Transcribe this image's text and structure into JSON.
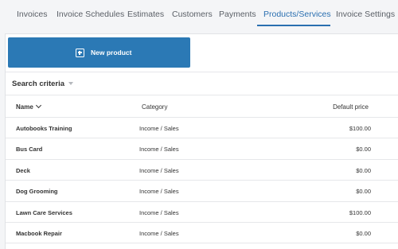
{
  "tabs": [
    {
      "label": "Invoices",
      "active": false
    },
    {
      "label": "Invoice Schedules",
      "active": false
    },
    {
      "label": "Estimates",
      "active": false
    },
    {
      "label": "Customers",
      "active": false
    },
    {
      "label": "Payments",
      "active": false
    },
    {
      "label": "Products/Services",
      "active": true
    },
    {
      "label": "Invoice Settings",
      "active": false
    }
  ],
  "actions": {
    "new_product_label": "New product"
  },
  "search": {
    "label": "Search criteria"
  },
  "table": {
    "columns": {
      "name": "Name",
      "category": "Category",
      "price": "Default price"
    },
    "rows": [
      {
        "name": "Autobooks Training",
        "category": "Income / Sales",
        "price": "$100.00"
      },
      {
        "name": "Bus Card",
        "category": "Income / Sales",
        "price": "$0.00"
      },
      {
        "name": "Deck",
        "category": "Income / Sales",
        "price": "$0.00"
      },
      {
        "name": "Dog Grooming",
        "category": "Income / Sales",
        "price": "$0.00"
      },
      {
        "name": "Lawn Care Services",
        "category": "Income / Sales",
        "price": "$100.00"
      },
      {
        "name": "Macbook Repair",
        "category": "Income / Sales",
        "price": "$0.00"
      }
    ]
  },
  "colors": {
    "accent": "#2a6fb0",
    "button": "#2b79b5",
    "background": "#f4f5f7"
  },
  "icons": {
    "new_product": "plus-square-icon",
    "search_toggle": "caret-down-icon",
    "sort": "chevron-down-icon"
  }
}
